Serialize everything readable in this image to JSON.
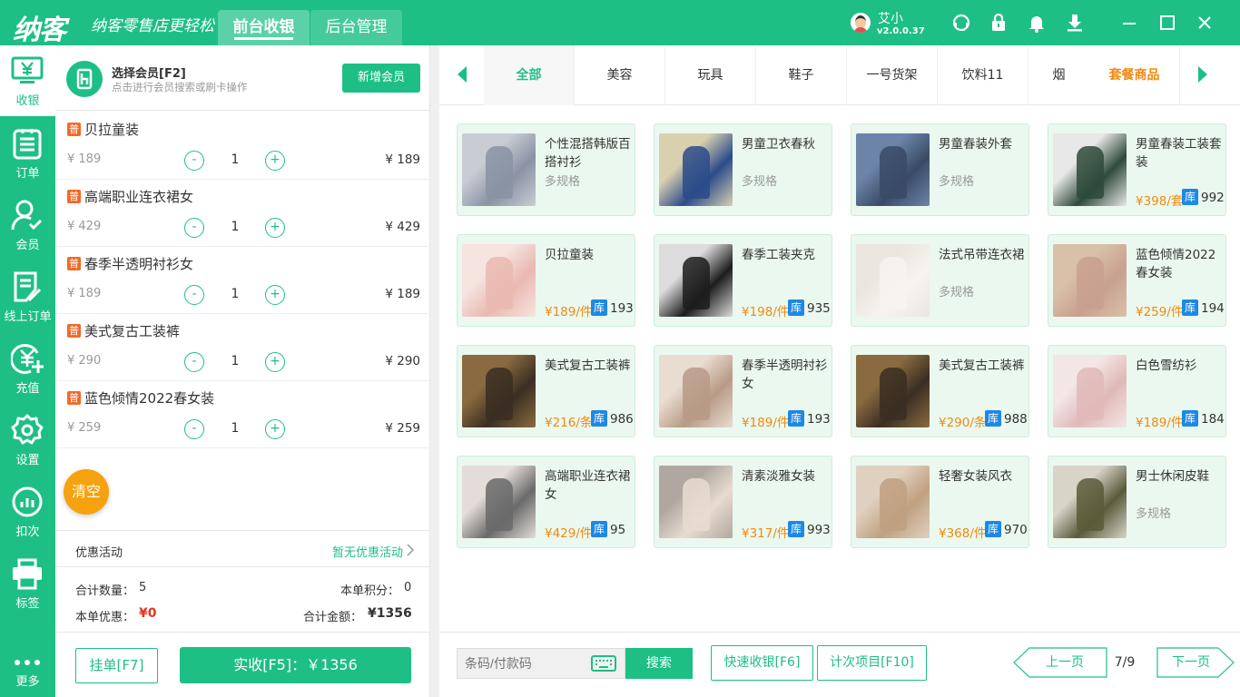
{
  "app": {
    "logo": "纳客",
    "slogan": "纳客零售店更轻松",
    "tabs": [
      "前台收银",
      "后台管理"
    ]
  },
  "user": {
    "name": "艾小",
    "version": "v2.0.0.37"
  },
  "sidebar": [
    {
      "label": "收银",
      "icon": "monitor-yen-icon"
    },
    {
      "label": "订单",
      "icon": "order-list-icon"
    },
    {
      "label": "会员",
      "icon": "member-icon"
    },
    {
      "label": "线上订单",
      "icon": "online-order-icon"
    },
    {
      "label": "充值",
      "icon": "recharge-icon"
    },
    {
      "label": "设置",
      "icon": "gear-icon"
    },
    {
      "label": "扣次",
      "icon": "count-chart-icon"
    },
    {
      "label": "标签",
      "icon": "printer-icon"
    },
    {
      "label": "更多",
      "icon": "more-dots-icon"
    }
  ],
  "member": {
    "title": "选择会员[F2]",
    "subtitle": "点击进行会员搜索或刷卡操作",
    "add_label": "新增会员"
  },
  "cart": {
    "tag": "普",
    "items": [
      {
        "name": "贝拉童装",
        "price": "¥ 189",
        "qty": "1",
        "total": "¥ 189"
      },
      {
        "name": "高端职业连衣裙女",
        "price": "¥ 429",
        "qty": "1",
        "total": "¥ 429"
      },
      {
        "name": "春季半透明衬衫女",
        "price": "¥ 189",
        "qty": "1",
        "total": "¥ 189"
      },
      {
        "name": "美式复古工装裤",
        "price": "¥ 290",
        "qty": "1",
        "total": "¥ 290"
      },
      {
        "name": "蓝色倾情2022春女装",
        "price": "¥ 259",
        "qty": "1",
        "total": "¥ 259"
      }
    ],
    "minus": "-",
    "plus": "+",
    "clear": "清空"
  },
  "promo": {
    "label": "优惠活动",
    "value": "暂无优惠活动"
  },
  "summary": {
    "qty_label": "合计数量：",
    "qty": "5",
    "points_label": "本单积分：",
    "points": "0",
    "discount_label": "本单优惠：",
    "discount": "¥0",
    "total_label": "合计金额：",
    "total": "¥1356"
  },
  "actions": {
    "hold": "挂单[F7]",
    "pay": "实收[F5]：￥1356"
  },
  "categories": [
    "全部",
    "美容",
    "玩具",
    "鞋子",
    "一号货架",
    "饮料11",
    "烟",
    "套餐商品"
  ],
  "stock_tag": "库",
  "products": [
    {
      "name": "个性混搭韩版百搭衬衫",
      "spec": "多规格",
      "price": "",
      "stock": "",
      "c1": "#c9ccd4",
      "c2": "#8a92a4"
    },
    {
      "name": "男童卫衣春秋",
      "spec": "多规格",
      "price": "",
      "stock": "",
      "c1": "#d9d0b0",
      "c2": "#2a4b8a"
    },
    {
      "name": "男童春装外套",
      "spec": "多规格",
      "price": "",
      "stock": "",
      "c1": "#6b84a8",
      "c2": "#3a4a66"
    },
    {
      "name": "男童春装工装套装",
      "spec": "",
      "price": "¥398/套",
      "stock": "992",
      "c1": "#e8e8e8",
      "c2": "#2e4a3a"
    },
    {
      "name": "贝拉童装",
      "spec": "",
      "price": "¥189/件",
      "stock": "193",
      "c1": "#f6e4e0",
      "c2": "#eab8b0"
    },
    {
      "name": "春季工装夹克",
      "spec": "",
      "price": "¥198/件",
      "stock": "935",
      "c1": "#dcdcdc",
      "c2": "#1c1c1c"
    },
    {
      "name": "法式吊带连衣裙",
      "spec": "多规格",
      "price": "",
      "stock": "",
      "c1": "#ebe6df",
      "c2": "#f7f3ee"
    },
    {
      "name": "蓝色倾情2022春女装",
      "spec": "",
      "price": "¥259/件",
      "stock": "194",
      "c1": "#d9c0a8",
      "c2": "#c8a090"
    },
    {
      "name": "美式复古工装裤",
      "spec": "",
      "price": "¥216/条",
      "stock": "986",
      "c1": "#8a6a40",
      "c2": "#3a2e22"
    },
    {
      "name": "春季半透明衬衫女",
      "spec": "",
      "price": "¥189/件",
      "stock": "193",
      "c1": "#e9dcd0",
      "c2": "#b79a86"
    },
    {
      "name": "美式复古工装裤",
      "spec": "",
      "price": "¥290/条",
      "stock": "988",
      "c1": "#8a6a40",
      "c2": "#3a2e22"
    },
    {
      "name": "白色雪纺衫",
      "spec": "",
      "price": "¥189/件",
      "stock": "184",
      "c1": "#f3e6e6",
      "c2": "#e0b8b8"
    },
    {
      "name": "高端职业连衣裙女",
      "spec": "",
      "price": "¥429/件",
      "stock": "95",
      "c1": "#e4dcd8",
      "c2": "#6a6a6a"
    },
    {
      "name": "清素淡雅女装",
      "spec": "",
      "price": "¥317/件",
      "stock": "993",
      "c1": "#b0a8a0",
      "c2": "#e8dcd0"
    },
    {
      "name": "轻奢女装风衣",
      "spec": "",
      "price": "¥368/件",
      "stock": "970",
      "c1": "#e0d0c0",
      "c2": "#c0a080"
    },
    {
      "name": "男士休闲皮鞋",
      "spec": "多规格",
      "price": "",
      "stock": "",
      "c1": "#d8d4c8",
      "c2": "#5a5a3a"
    }
  ],
  "bottom": {
    "search_placeholder": "条码/付款码",
    "search": "搜索",
    "quick": "快速收银[F6]",
    "count_items": "计次项目[F10]",
    "prev": "上一页",
    "page": "7/9",
    "next": "下一页"
  },
  "colors": {
    "brand": "#1dbf85",
    "price": "#f08a0e",
    "stock": "#1e88e5",
    "clear": "#f6a10e",
    "tag": "#f06a2a",
    "discount": "#e8341c"
  }
}
